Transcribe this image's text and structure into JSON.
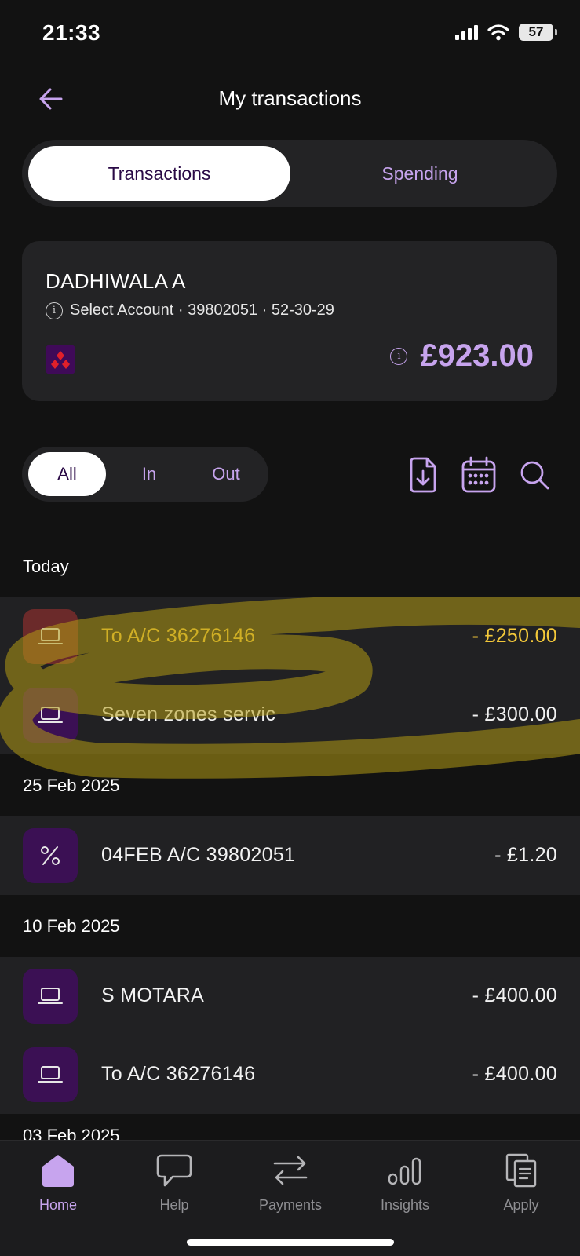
{
  "status_bar": {
    "time": "21:33",
    "battery": "57"
  },
  "header": {
    "title": "My transactions"
  },
  "segment_tabs": {
    "active": "Transactions",
    "inactive": "Spending"
  },
  "account": {
    "name": "DADHIWALA A",
    "details": "Select Account · 39802051 · 52-30-29",
    "balance": "£923.00"
  },
  "filters": {
    "all": "All",
    "in": "In",
    "out": "Out"
  },
  "sections": [
    {
      "label": "Today",
      "transactions": [
        {
          "name": "To A/C 36276146",
          "amount": "- £250.00",
          "icon": "laptop-icon",
          "highlighted": true
        },
        {
          "name": "Seven zones servic",
          "amount": "- £300.00",
          "icon": "laptop-icon",
          "highlighted": false
        }
      ]
    },
    {
      "label": "25 Feb 2025",
      "transactions": [
        {
          "name": "04FEB A/C 39802051",
          "amount": "- £1.20",
          "icon": "percent-icon"
        }
      ]
    },
    {
      "label": "10 Feb 2025",
      "transactions": [
        {
          "name": "S MOTARA",
          "amount": "- £400.00",
          "icon": "laptop-icon"
        },
        {
          "name": "To A/C 36276146",
          "amount": "- £400.00",
          "icon": "laptop-icon"
        }
      ]
    }
  ],
  "partial_section_label": "03 Feb 2025",
  "tab_bar": {
    "home": "Home",
    "help": "Help",
    "payments": "Payments",
    "insights": "Insights",
    "apply": "Apply"
  },
  "colors": {
    "accent": "#c7a4ee",
    "background": "#121212",
    "card": "#232325",
    "highlight": "#f3c83a"
  }
}
